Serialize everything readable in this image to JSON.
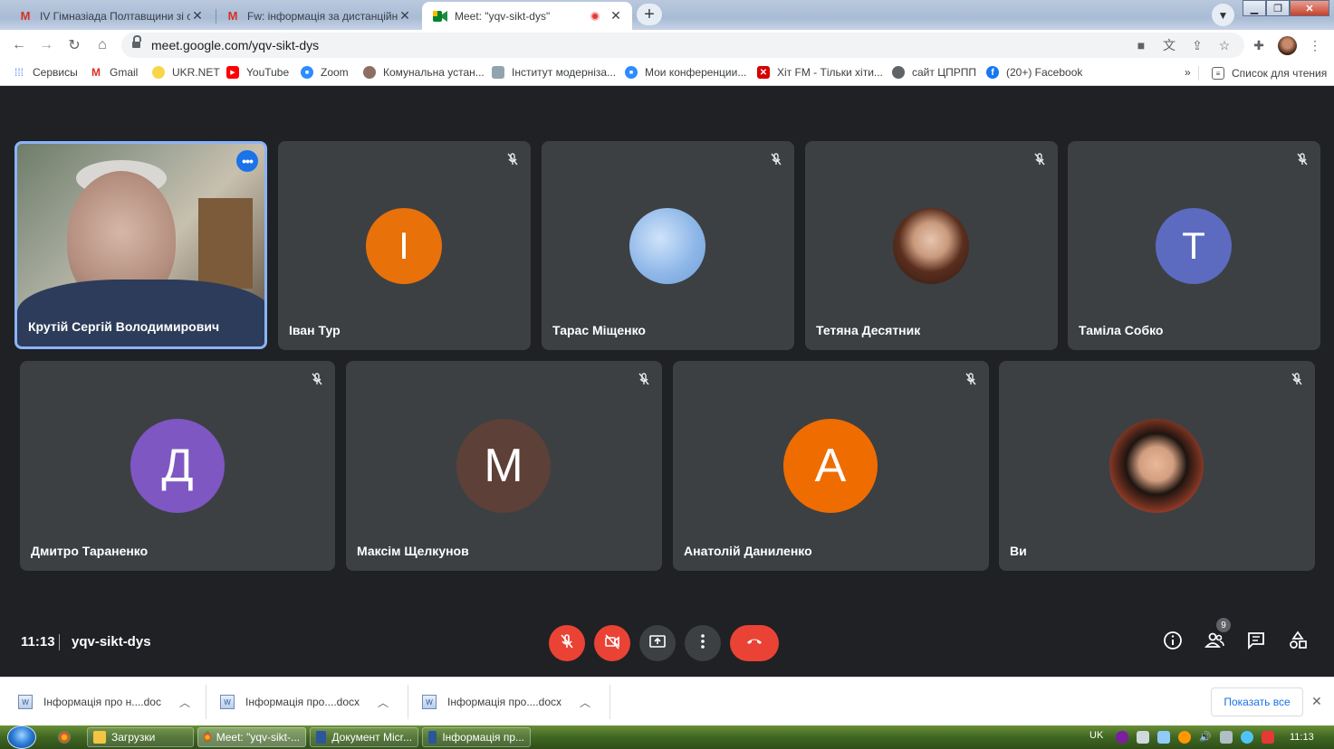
{
  "browser": {
    "tabs": [
      {
        "title": "IV Гімназіада Полтавщини зі спорту",
        "icon": "gmail-icon"
      },
      {
        "title": "Fw: інформація за дистанційне навчання",
        "icon": "gmail-icon"
      },
      {
        "title": "Meet: \"yqv-sikt-dys\"",
        "icon": "meet-icon",
        "active": true
      }
    ],
    "url": "meet.google.com/yqv-sikt-dys",
    "bookmarks": [
      {
        "label": "Сервисы",
        "icon": "apps-grid-icon"
      },
      {
        "label": "Gmail",
        "icon": "gmail-icon"
      },
      {
        "label": "UKR.NET",
        "icon": "ukrnet-icon"
      },
      {
        "label": "YouTube",
        "icon": "youtube-icon"
      },
      {
        "label": "Zoom",
        "icon": "zoom-icon"
      },
      {
        "label": "Комунальна устан...",
        "icon": "site-icon"
      },
      {
        "label": "Інститут модерніза...",
        "icon": "site-icon"
      },
      {
        "label": "Мои конференции...",
        "icon": "zoom-icon"
      },
      {
        "label": "Хіт FM - Тільки хіти...",
        "icon": "hitfm-icon"
      },
      {
        "label": "сайт ЦПРПП",
        "icon": "globe-icon"
      },
      {
        "label": "(20+) Facebook",
        "icon": "facebook-icon"
      }
    ],
    "bookmarks_overflow": "»",
    "reading_list": "Список для чтения"
  },
  "meet": {
    "participants": [
      {
        "name": "Крутій Сергій Володимирович",
        "type": "video"
      },
      {
        "name": "Іван Тур",
        "initial": "І",
        "color": "#e8710a"
      },
      {
        "name": "Тарас Міщенко",
        "type": "photo",
        "color": "#8fb8e8"
      },
      {
        "name": "Тетяна Десятник",
        "type": "photo",
        "color": "#c99a7d"
      },
      {
        "name": "Таміла Собко",
        "initial": "Т",
        "color": "#5c6bc0"
      },
      {
        "name": "Дмитро Тараненко",
        "initial": "Д",
        "color": "#7e57c2"
      },
      {
        "name": "Максім Щелкунов",
        "initial": "М",
        "color": "#5d4037"
      },
      {
        "name": "Анатолій Даниленко",
        "initial": "А",
        "color": "#ef6c00"
      },
      {
        "name": "Ви",
        "type": "photo",
        "color": "#b5482e"
      }
    ],
    "time": "11:13",
    "meeting_code": "yqv-sikt-dys",
    "participant_count": "9",
    "more_dots": "•••"
  },
  "downloads": {
    "items": [
      {
        "name": "Інформація про н....doc"
      },
      {
        "name": "Інформація про....docx"
      },
      {
        "name": "Інформація про....docx"
      }
    ],
    "show_all": "Показать все"
  },
  "taskbar": {
    "items": [
      {
        "label": "Загрузки"
      },
      {
        "label": "Meet: \"yqv-sikt-..."
      },
      {
        "label": "Документ Micr..."
      },
      {
        "label": "Інформація пр..."
      }
    ],
    "lang": "UK",
    "clock": "11:13"
  },
  "colors": {
    "meet_bg": "#202124",
    "tile_bg": "#3c4043",
    "danger": "#ea4335",
    "accent": "#1a73e8"
  }
}
